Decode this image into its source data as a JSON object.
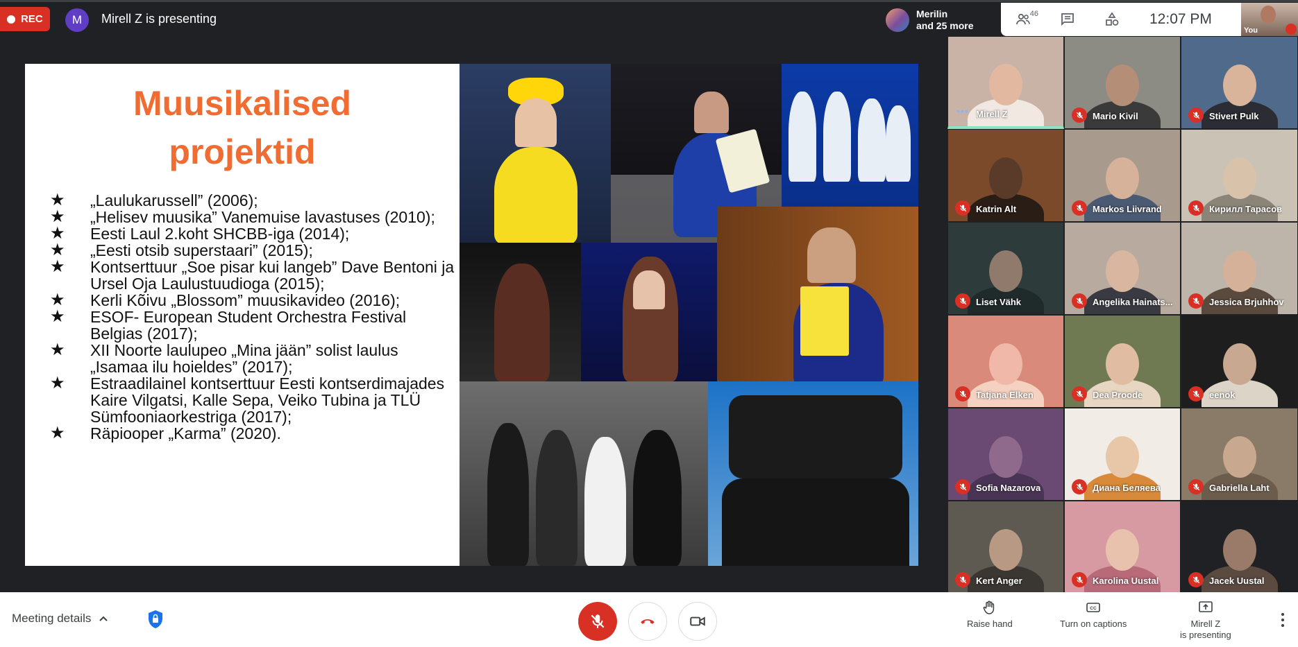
{
  "topbar": {
    "rec_label": "REC",
    "presenter_initial": "M",
    "presenter_text": "Mirell Z is presenting",
    "people_chip_line1": "Merilin",
    "people_chip_line2": "and 25 more",
    "people_count": "46",
    "clock": "12:07 PM",
    "self_label": "You"
  },
  "slide": {
    "title_line1": "Muusikalised",
    "title_line2": "projektid",
    "bullets": [
      "„Laulukarussell” (2006);",
      "„Helisev muusika” Vanemuise lavastuses (2010);",
      "Eesti Laul 2.koht SHCBB-iga (2014);",
      "„Eesti otsib superstaari” (2015);",
      "Kontserttuur „Soe pisar kui langeb” Dave Bentoni ja Ursel Oja Laulustuudioga (2015);",
      "Kerli Kõivu „Blossom” muusikavideo (2016);",
      "ESOF- European Student Orchestra Festival Belgias (2017);",
      "XII Noorte laulupeo „Mina jään” solist laulus „Isamaa ilu hoieldes” (2017);",
      "Estraadilainel kontserttuur Eesti kontserdimajades Kaire Vilgatsi, Kalle Sepa, Veiko Tubina ja TLÜ Sümfooniaorkestriga (2017);",
      "Räpiooper „Karma” (2020)."
    ]
  },
  "participants": [
    {
      "name": "Mirell Z",
      "muted": false,
      "speaking": true,
      "bg": "#c9b3a6",
      "skin": "#e2b9a0",
      "shirt": "#f1e8e2"
    },
    {
      "name": "Mario Kivil",
      "muted": true,
      "speaking": false,
      "bg": "#8c8c84",
      "skin": "#b58e78",
      "shirt": "#3a3a3a"
    },
    {
      "name": "Stivert Pulk",
      "muted": true,
      "speaking": false,
      "bg": "#4f6a8a",
      "skin": "#d9b49a",
      "shirt": "#2c2c34"
    },
    {
      "name": "Katrin Alt",
      "muted": true,
      "speaking": false,
      "bg": "#7a4a2a",
      "skin": "#5a3a28",
      "shirt": "#2a1d16"
    },
    {
      "name": "Markos Liivrand",
      "muted": true,
      "speaking": false,
      "bg": "#a89a8c",
      "skin": "#d7b29a",
      "shirt": "#4b5a73"
    },
    {
      "name": "Кирилл Тарасов",
      "muted": true,
      "speaking": false,
      "bg": "#c9c2b5",
      "skin": "#d8c3aa",
      "shirt": "#8b8478"
    },
    {
      "name": "Liset Vähk",
      "muted": true,
      "speaking": false,
      "bg": "#2d3b3a",
      "skin": "#8f7a6c",
      "shirt": "#1f2a2a"
    },
    {
      "name": "Angelika Hainats...",
      "muted": true,
      "speaking": false,
      "bg": "#b8aa9e",
      "skin": "#d9b6a0",
      "shirt": "#3a3a42"
    },
    {
      "name": "Jessica Brjuhhov",
      "muted": true,
      "speaking": false,
      "bg": "#bdb4aa",
      "skin": "#d6b19a",
      "shirt": "#5a4a3e"
    },
    {
      "name": "Tatjana Elken",
      "muted": true,
      "speaking": false,
      "bg": "#d98a7a",
      "skin": "#f0b8a8",
      "shirt": "#f4d1c0"
    },
    {
      "name": "Dea Proode",
      "muted": true,
      "speaking": false,
      "bg": "#6f7a52",
      "skin": "#e0bca2",
      "shirt": "#e6d6c2"
    },
    {
      "name": "eenok",
      "muted": true,
      "speaking": false,
      "bg": "#1e1e1e",
      "skin": "#c8a890",
      "shirt": "#dcd4c6"
    },
    {
      "name": "Sofia Nazarova",
      "muted": true,
      "speaking": false,
      "bg": "#6a4a72",
      "skin": "#8f6a8c",
      "shirt": "#4a3456"
    },
    {
      "name": "Диана Беляева",
      "muted": true,
      "speaking": false,
      "bg": "#f1ece6",
      "skin": "#e8c7a8",
      "shirt": "#d88a3a"
    },
    {
      "name": "Gabriella Laht",
      "muted": true,
      "speaking": false,
      "bg": "#8a7a68",
      "skin": "#c9a890",
      "shirt": "#6c5c4c"
    },
    {
      "name": "Kert Anger",
      "muted": true,
      "speaking": false,
      "bg": "#5e5a52",
      "skin": "#b89a84",
      "shirt": "#3a3632"
    },
    {
      "name": "Karolina Uustal",
      "muted": true,
      "speaking": false,
      "bg": "#d89aa2",
      "skin": "#e9c2ae",
      "shirt": "#b86a78"
    },
    {
      "name": "Jacek Uustal",
      "muted": true,
      "speaking": false,
      "bg": "#202124",
      "skin": "#9a7a68",
      "shirt": "#5a4a40"
    }
  ],
  "bottombar": {
    "meeting_details": "Meeting details",
    "raise_hand": "Raise hand",
    "captions": "Turn on captions",
    "presenting_line1": "Mirell Z",
    "presenting_line2": "is presenting"
  },
  "colors": {
    "accent_red": "#d93025",
    "title_orange": "#ef6c33",
    "speaking_bar": "#8de2c3"
  }
}
